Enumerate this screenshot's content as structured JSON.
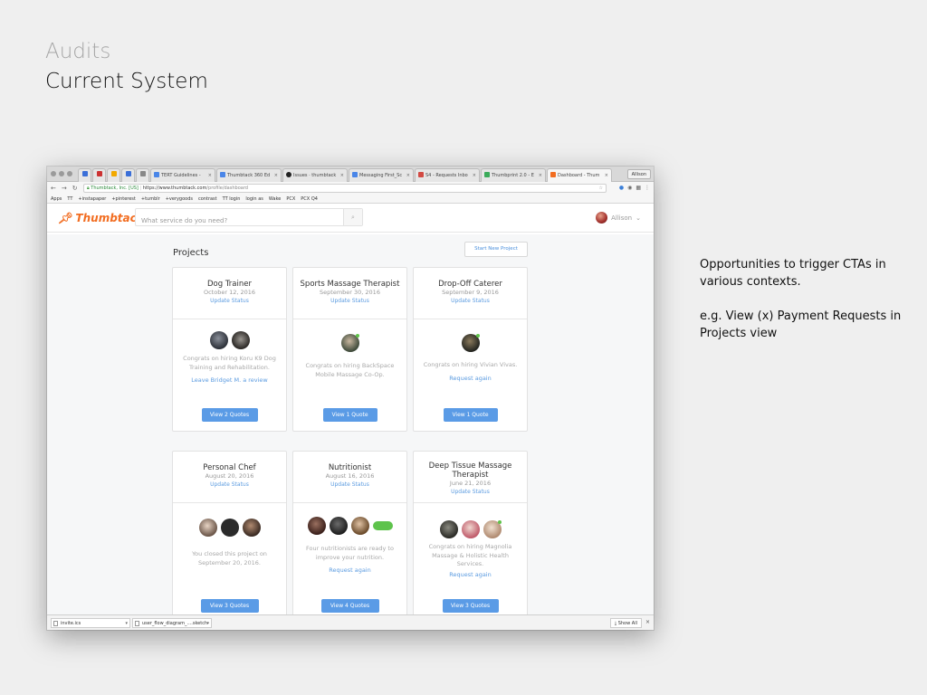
{
  "slide": {
    "supertitle": "Audits",
    "title": "Current System",
    "note_line1": "Opportunities to trigger CTAs in various contexts.",
    "note_line2": "e.g. View (x) Payment Requests in Projects view"
  },
  "browser": {
    "tabs": [
      {
        "label": "",
        "color": "#3b6fd8"
      },
      {
        "label": "",
        "color": "#c33"
      },
      {
        "label": "",
        "color": "#f2a900"
      },
      {
        "label": "",
        "color": "#3b6fd8"
      },
      {
        "label": "",
        "color": "#888"
      },
      {
        "label": "TERT Guidelines -",
        "color": "#4a86e8"
      },
      {
        "label": "Thumbtack 360 Ed",
        "color": "#4a86e8"
      },
      {
        "label": "Issues · thumbtack",
        "color": "#222"
      },
      {
        "label": "Messaging First_Sc",
        "color": "#4a86e8"
      },
      {
        "label": "S4 - Requests Inbo",
        "color": "#d24a43"
      },
      {
        "label": "Thumbprint 2.0 - E",
        "color": "#3bab5a"
      },
      {
        "label": "Dashboard - Thum",
        "color": "#f26d21"
      }
    ],
    "profile": "Allison",
    "address": {
      "secure_label": "Thumbtack, Inc. [US]",
      "url_host": "https://www.thumbtack.com",
      "url_path": "/profile/dashboard"
    },
    "bookmarks": [
      "Apps",
      "TT",
      "+instapaper",
      "+pinterest",
      "+tumblr",
      "+verygoods",
      "contrast",
      "TT login",
      "login as",
      "Wake",
      "PCX",
      "PCX Q4"
    ]
  },
  "site": {
    "logo": "Thumbtack",
    "search_placeholder": "What service do you need?",
    "user_name": "Allison",
    "projects_title": "Projects",
    "new_project_label": "Start New Project"
  },
  "cards": [
    {
      "name": "Dog Trainer",
      "date": "October 12, 2016",
      "update": "Update Status",
      "message": "Congrats on hiring Koru K9 Dog Training and Rehabilitation.",
      "link": "Leave Bridget M. a review",
      "button": "View 2 Quotes"
    },
    {
      "name": "Sports Massage Therapist",
      "date": "September 30, 2016",
      "update": "Update Status",
      "message": "Congrats on hiring BackSpace Mobile Massage Co-Op.",
      "link": "",
      "button": "View 1 Quote"
    },
    {
      "name": "Drop-Off Caterer",
      "date": "September 9, 2016",
      "update": "Update Status",
      "message": "Congrats on hiring Vivian Vivas.",
      "link": "Request again",
      "button": "View 1 Quote"
    },
    {
      "name": "Personal Chef",
      "date": "August 20, 2016",
      "update": "Update Status",
      "message": "You closed this project on September 20, 2016.",
      "link": "",
      "button": "View 3 Quotes"
    },
    {
      "name": "Nutritionist",
      "date": "August 16, 2016",
      "update": "Update Status",
      "message": "Four nutritionists are ready to improve your nutrition.",
      "link": "Request again",
      "button": "View 4 Quotes"
    },
    {
      "name": "Deep Tissue Massage Therapist",
      "date": "June 21, 2016",
      "update": "Update Status",
      "message": "Congrats on hiring Magnolia Massage & Holistic Health Services.",
      "link": "Request again",
      "button": "View 3 Quotes"
    }
  ],
  "downloads": {
    "file1": "invite.ics",
    "file2": "user_flow_diagram_....sketch",
    "show_all": "Show All"
  },
  "colors": {
    "brand": "#f26d21",
    "primary_button": "#5a9be6",
    "link": "#5b9be0"
  }
}
